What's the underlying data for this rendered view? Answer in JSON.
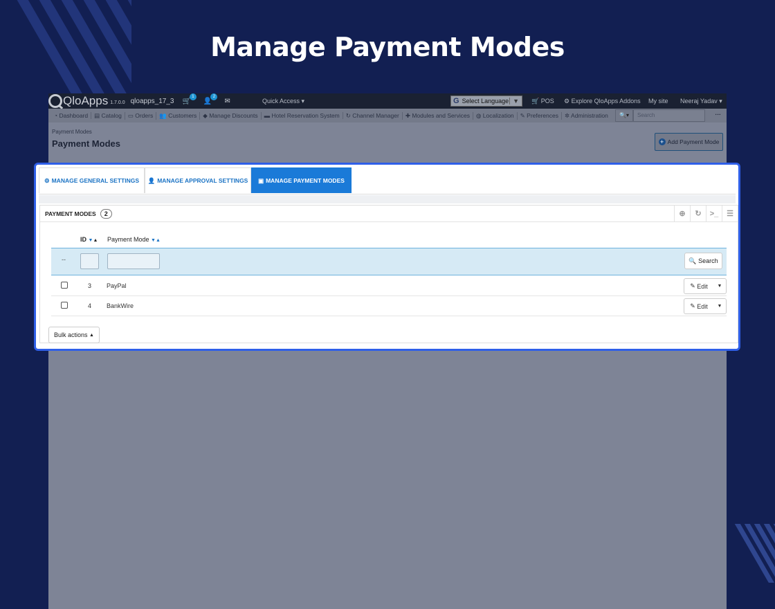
{
  "headline": "Manage Payment Modes",
  "topbar": {
    "brand": "QloApps",
    "version": "1.7.0.0",
    "shop_name": "qloapps_17_3",
    "cart_badge": "1",
    "customer_badge": "2",
    "quick_access": "Quick Access ▾",
    "select_language": "Select Language",
    "lang_arrow": "▼",
    "pos": "POS",
    "addons": "Explore QloApps Addons",
    "my_site": "My site",
    "user": "Neeraj Yadav ▾"
  },
  "menu": {
    "items": [
      "Dashboard",
      "Catalog",
      "Orders",
      "Customers",
      "Manage Discounts",
      "Hotel Reservation System",
      "Channel Manager",
      "Modules and Services",
      "Localization",
      "Preferences",
      "Administration"
    ],
    "search_placeholder": "Search",
    "more": "···"
  },
  "page": {
    "breadcrumb": "Payment Modes",
    "title": "Payment Modes",
    "add_button": "Add Payment Mode"
  },
  "tabs": [
    {
      "label": "MANAGE GENERAL SETTINGS",
      "icon": "cogs-icon"
    },
    {
      "label": "MANAGE APPROVAL SETTINGS",
      "icon": "user-icon"
    },
    {
      "label": "MANAGE PAYMENT MODES",
      "icon": "money-icon",
      "active": true
    }
  ],
  "panel": {
    "title": "PAYMENT MODES",
    "count": "2",
    "columns": {
      "id": "ID",
      "mode": "Payment Mode"
    },
    "filter_dash": "--",
    "search_button": "Search",
    "rows": [
      {
        "id": "3",
        "name": "PayPal",
        "action": "Edit"
      },
      {
        "id": "4",
        "name": "BankWire",
        "action": "Edit"
      }
    ],
    "bulk_actions": "Bulk actions"
  },
  "colors": {
    "background": "#121f52",
    "accent": "#2f5fe8",
    "active_tab": "#1a7ad8"
  }
}
